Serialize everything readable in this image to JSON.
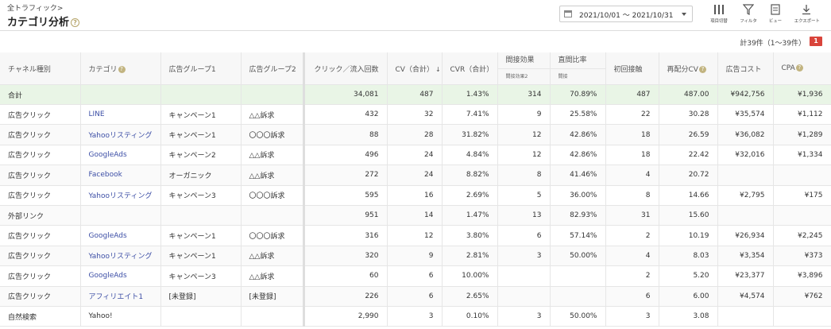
{
  "header": {
    "breadcrumb": "全トラフィック>",
    "title": "カテゴリ分析",
    "help": "?"
  },
  "date_range": "2021/10/01 ～ 2021/10/31",
  "toolbar": {
    "columns_label": "項目切替",
    "filter_label": "フィルタ",
    "view_label": "ビュー",
    "export_label": "エクスポート"
  },
  "pagination": {
    "count_text": "計39件（1〜39件）",
    "page": "1"
  },
  "colors": {
    "accent_link": "#3d4fa6",
    "total_row_bg": "#e9f5e6",
    "badge": "#d9443b"
  },
  "table": {
    "headers": {
      "channel": "チャネル種別",
      "category": "カテゴリ",
      "adgroup1": "広告グループ1",
      "adgroup2": "広告グループ2",
      "clicks": "クリック／流入回数",
      "cv": "CV（合計）",
      "sort": "↓",
      "cvr": "CVR（合計）",
      "indirect": "間接効果",
      "indirect_sub": "間接効果2",
      "direct_ratio": "直間比率",
      "direct_sub": "間接",
      "first": "初回接触",
      "recv": "再配分CV",
      "adcost": "広告コスト",
      "cpa": "CPA"
    },
    "total": {
      "label": "合計",
      "clicks": "34,081",
      "cv": "487",
      "cvr": "1.43%",
      "indirect": "314",
      "ratio": "70.89%",
      "first": "487",
      "recv": "487.00",
      "cost": "¥942,756",
      "cpa": "¥1,936"
    },
    "rows": [
      {
        "channel": "広告クリック",
        "category": "LINE",
        "g1": "キャンペーン1",
        "g2": "△△訴求",
        "clicks": "432",
        "cv": "32",
        "cvr": "7.41%",
        "indirect": "9",
        "ratio": "25.58%",
        "first": "22",
        "recv": "30.28",
        "cost": "¥35,574",
        "cpa": "¥1,112"
      },
      {
        "channel": "広告クリック",
        "category": "Yahooリスティング",
        "g1": "キャンペーン1",
        "g2": "〇〇〇訴求",
        "clicks": "88",
        "cv": "28",
        "cvr": "31.82%",
        "indirect": "12",
        "ratio": "42.86%",
        "first": "18",
        "recv": "26.59",
        "cost": "¥36,082",
        "cpa": "¥1,289"
      },
      {
        "channel": "広告クリック",
        "category": "GoogleAds",
        "g1": "キャンペーン2",
        "g2": "△△訴求",
        "clicks": "496",
        "cv": "24",
        "cvr": "4.84%",
        "indirect": "12",
        "ratio": "42.86%",
        "first": "18",
        "recv": "22.42",
        "cost": "¥32,016",
        "cpa": "¥1,334"
      },
      {
        "channel": "広告クリック",
        "category": "Facebook",
        "g1": "オーガニック",
        "g2": "△△訴求",
        "clicks": "272",
        "cv": "24",
        "cvr": "8.82%",
        "indirect": "8",
        "ratio": "41.46%",
        "first": "4",
        "recv": "20.72",
        "cost": "",
        "cpa": ""
      },
      {
        "channel": "広告クリック",
        "category": "Yahooリスティング",
        "g1": "キャンペーン3",
        "g2": "〇〇〇訴求",
        "clicks": "595",
        "cv": "16",
        "cvr": "2.69%",
        "indirect": "5",
        "ratio": "36.00%",
        "first": "8",
        "recv": "14.66",
        "cost": "¥2,795",
        "cpa": "¥175"
      },
      {
        "channel": "外部リンク",
        "category": "",
        "g1": "",
        "g2": "",
        "clicks": "951",
        "cv": "14",
        "cvr": "1.47%",
        "indirect": "13",
        "ratio": "82.93%",
        "first": "31",
        "recv": "15.60",
        "cost": "",
        "cpa": ""
      },
      {
        "channel": "広告クリック",
        "category": "GoogleAds",
        "g1": "キャンペーン1",
        "g2": "〇〇〇訴求",
        "clicks": "316",
        "cv": "12",
        "cvr": "3.80%",
        "indirect": "6",
        "ratio": "57.14%",
        "first": "2",
        "recv": "10.19",
        "cost": "¥26,934",
        "cpa": "¥2,245"
      },
      {
        "channel": "広告クリック",
        "category": "Yahooリスティング",
        "g1": "キャンペーン1",
        "g2": "△△訴求",
        "clicks": "320",
        "cv": "9",
        "cvr": "2.81%",
        "indirect": "3",
        "ratio": "50.00%",
        "first": "4",
        "recv": "8.03",
        "cost": "¥3,354",
        "cpa": "¥373"
      },
      {
        "channel": "広告クリック",
        "category": "GoogleAds",
        "g1": "キャンペーン3",
        "g2": "△△訴求",
        "clicks": "60",
        "cv": "6",
        "cvr": "10.00%",
        "indirect": "",
        "ratio": "",
        "first": "2",
        "recv": "5.20",
        "cost": "¥23,377",
        "cpa": "¥3,896"
      },
      {
        "channel": "広告クリック",
        "category": "アフィリエイト1",
        "g1": "[未登録]",
        "g2": "[未登録]",
        "clicks": "226",
        "cv": "6",
        "cvr": "2.65%",
        "indirect": "",
        "ratio": "",
        "first": "6",
        "recv": "6.00",
        "cost": "¥4,574",
        "cpa": "¥762"
      },
      {
        "channel": "自然検索",
        "category": "Yahoo!",
        "g1": "",
        "g2": "",
        "clicks": "2,990",
        "cv": "3",
        "cvr": "0.10%",
        "indirect": "3",
        "ratio": "50.00%",
        "first": "3",
        "recv": "3.08",
        "cost": "",
        "cpa": ""
      }
    ]
  }
}
